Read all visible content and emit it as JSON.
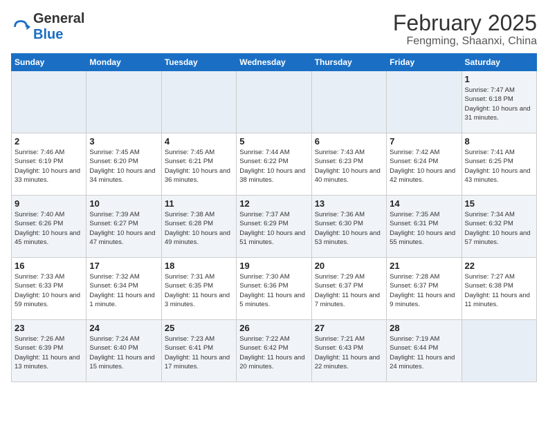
{
  "logo": {
    "general": "General",
    "blue": "Blue"
  },
  "title": "February 2025",
  "subtitle": "Fengming, Shaanxi, China",
  "weekdays": [
    "Sunday",
    "Monday",
    "Tuesday",
    "Wednesday",
    "Thursday",
    "Friday",
    "Saturday"
  ],
  "weeks": [
    [
      {
        "day": "",
        "info": ""
      },
      {
        "day": "",
        "info": ""
      },
      {
        "day": "",
        "info": ""
      },
      {
        "day": "",
        "info": ""
      },
      {
        "day": "",
        "info": ""
      },
      {
        "day": "",
        "info": ""
      },
      {
        "day": "1",
        "info": "Sunrise: 7:47 AM\nSunset: 6:18 PM\nDaylight: 10 hours and 31 minutes."
      }
    ],
    [
      {
        "day": "2",
        "info": "Sunrise: 7:46 AM\nSunset: 6:19 PM\nDaylight: 10 hours and 33 minutes."
      },
      {
        "day": "3",
        "info": "Sunrise: 7:45 AM\nSunset: 6:20 PM\nDaylight: 10 hours and 34 minutes."
      },
      {
        "day": "4",
        "info": "Sunrise: 7:45 AM\nSunset: 6:21 PM\nDaylight: 10 hours and 36 minutes."
      },
      {
        "day": "5",
        "info": "Sunrise: 7:44 AM\nSunset: 6:22 PM\nDaylight: 10 hours and 38 minutes."
      },
      {
        "day": "6",
        "info": "Sunrise: 7:43 AM\nSunset: 6:23 PM\nDaylight: 10 hours and 40 minutes."
      },
      {
        "day": "7",
        "info": "Sunrise: 7:42 AM\nSunset: 6:24 PM\nDaylight: 10 hours and 42 minutes."
      },
      {
        "day": "8",
        "info": "Sunrise: 7:41 AM\nSunset: 6:25 PM\nDaylight: 10 hours and 43 minutes."
      }
    ],
    [
      {
        "day": "9",
        "info": "Sunrise: 7:40 AM\nSunset: 6:26 PM\nDaylight: 10 hours and 45 minutes."
      },
      {
        "day": "10",
        "info": "Sunrise: 7:39 AM\nSunset: 6:27 PM\nDaylight: 10 hours and 47 minutes."
      },
      {
        "day": "11",
        "info": "Sunrise: 7:38 AM\nSunset: 6:28 PM\nDaylight: 10 hours and 49 minutes."
      },
      {
        "day": "12",
        "info": "Sunrise: 7:37 AM\nSunset: 6:29 PM\nDaylight: 10 hours and 51 minutes."
      },
      {
        "day": "13",
        "info": "Sunrise: 7:36 AM\nSunset: 6:30 PM\nDaylight: 10 hours and 53 minutes."
      },
      {
        "day": "14",
        "info": "Sunrise: 7:35 AM\nSunset: 6:31 PM\nDaylight: 10 hours and 55 minutes."
      },
      {
        "day": "15",
        "info": "Sunrise: 7:34 AM\nSunset: 6:32 PM\nDaylight: 10 hours and 57 minutes."
      }
    ],
    [
      {
        "day": "16",
        "info": "Sunrise: 7:33 AM\nSunset: 6:33 PM\nDaylight: 10 hours and 59 minutes."
      },
      {
        "day": "17",
        "info": "Sunrise: 7:32 AM\nSunset: 6:34 PM\nDaylight: 11 hours and 1 minute."
      },
      {
        "day": "18",
        "info": "Sunrise: 7:31 AM\nSunset: 6:35 PM\nDaylight: 11 hours and 3 minutes."
      },
      {
        "day": "19",
        "info": "Sunrise: 7:30 AM\nSunset: 6:36 PM\nDaylight: 11 hours and 5 minutes."
      },
      {
        "day": "20",
        "info": "Sunrise: 7:29 AM\nSunset: 6:37 PM\nDaylight: 11 hours and 7 minutes."
      },
      {
        "day": "21",
        "info": "Sunrise: 7:28 AM\nSunset: 6:37 PM\nDaylight: 11 hours and 9 minutes."
      },
      {
        "day": "22",
        "info": "Sunrise: 7:27 AM\nSunset: 6:38 PM\nDaylight: 11 hours and 11 minutes."
      }
    ],
    [
      {
        "day": "23",
        "info": "Sunrise: 7:26 AM\nSunset: 6:39 PM\nDaylight: 11 hours and 13 minutes."
      },
      {
        "day": "24",
        "info": "Sunrise: 7:24 AM\nSunset: 6:40 PM\nDaylight: 11 hours and 15 minutes."
      },
      {
        "day": "25",
        "info": "Sunrise: 7:23 AM\nSunset: 6:41 PM\nDaylight: 11 hours and 17 minutes."
      },
      {
        "day": "26",
        "info": "Sunrise: 7:22 AM\nSunset: 6:42 PM\nDaylight: 11 hours and 20 minutes."
      },
      {
        "day": "27",
        "info": "Sunrise: 7:21 AM\nSunset: 6:43 PM\nDaylight: 11 hours and 22 minutes."
      },
      {
        "day": "28",
        "info": "Sunrise: 7:19 AM\nSunset: 6:44 PM\nDaylight: 11 hours and 24 minutes."
      },
      {
        "day": "",
        "info": ""
      }
    ]
  ]
}
